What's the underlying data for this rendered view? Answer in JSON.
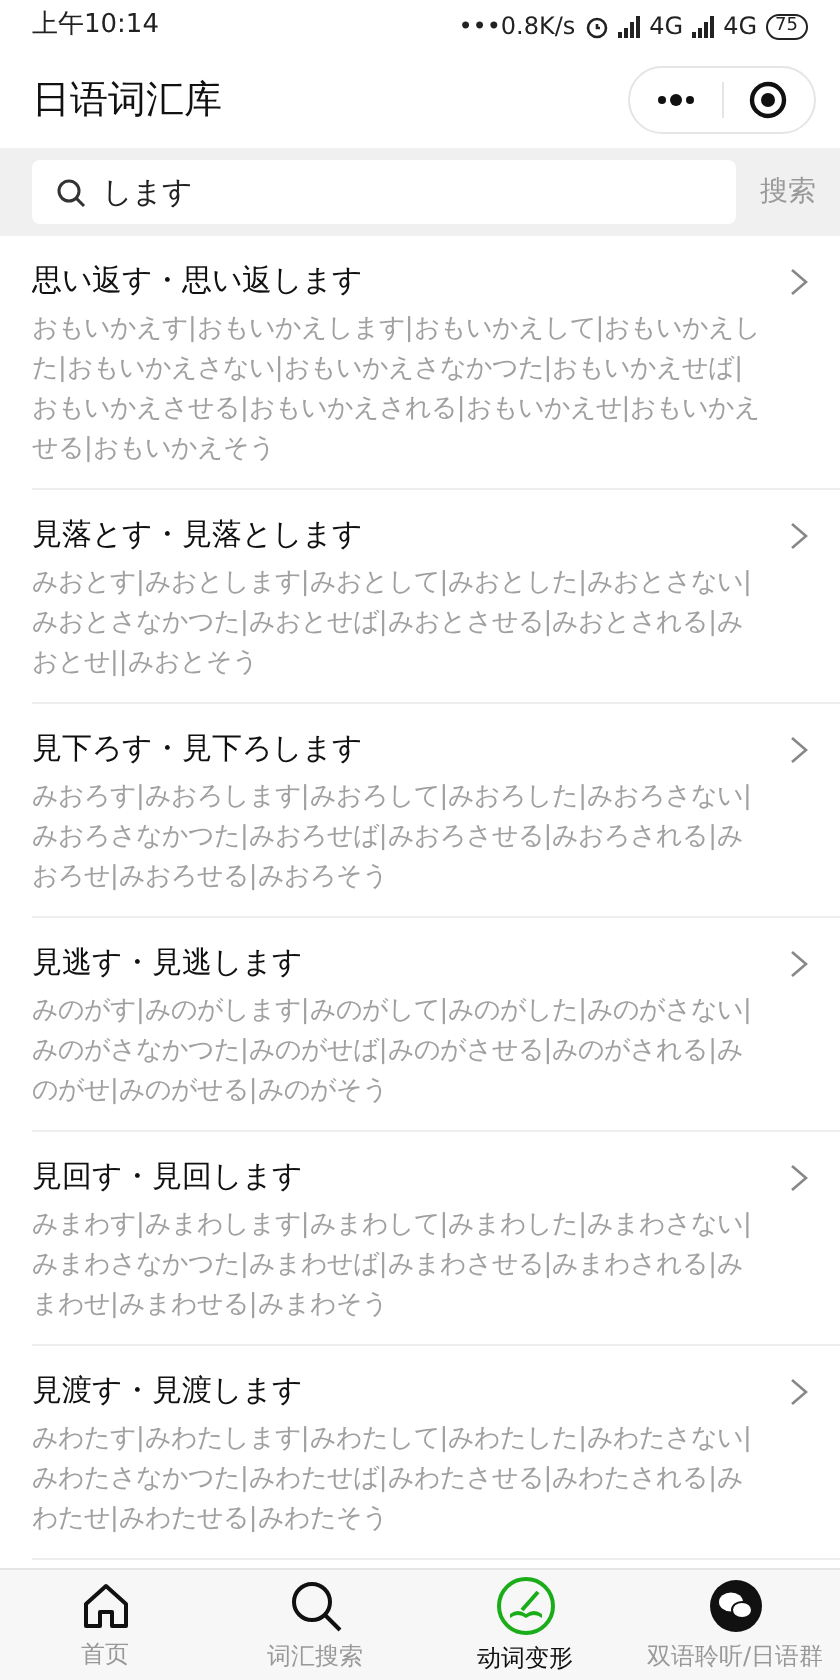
{
  "status_bar": {
    "time": "上午10:14",
    "speed": "•••0.8K/s",
    "network_1": "4G",
    "network_2": "4G",
    "battery": "75"
  },
  "header": {
    "title": "日语词汇库"
  },
  "search": {
    "value": "します",
    "button": "搜索"
  },
  "verbs": [
    {
      "title": "思い返す・思い返します",
      "forms": "おもいかえす|おもいかえします|おもいかえして|おもいかえした|おもいかえさない|おもいかえさなかつた|おもいかえせば|おもいかえさせる|おもいかえされる|おもいかえせ|おもいかえせる|おもいかえそう"
    },
    {
      "title": "見落とす・見落とします",
      "forms": "みおとす|みおとします|みおとして|みおとした|みおとさない|みおとさなかつた|みおとせば|みおとさせる|みおとされる|みおとせ||みおとそう"
    },
    {
      "title": "見下ろす・見下ろします",
      "forms": "みおろす|みおろします|みおろして|みおろした|みおろさない|みおろさなかつた|みおろせば|みおろさせる|みおろされる|みおろせ|みおろせる|みおろそう"
    },
    {
      "title": "見逃す・見逃します",
      "forms": "みのがす|みのがします|みのがして|みのがした|みのがさない|みのがさなかつた|みのがせば|みのがさせる|みのがされる|みのがせ|みのがせる|みのがそう"
    },
    {
      "title": "見回す・見回します",
      "forms": "みまわす|みまわします|みまわして|みまわした|みまわさない|みまわさなかつた|みまわせば|みまわさせる|みまわされる|みまわせ|みまわせる|みまわそう"
    },
    {
      "title": "見渡す・見渡します",
      "forms": "みわたす|みわたします|みわたして|みわたした|みわたさない|みわたさなかつた|みわたせば|みわたさせる|みわたされる|みわたせ|みわたせる|みわたそう"
    }
  ],
  "tabs": [
    {
      "kind": "home",
      "label": "首页",
      "selected": false
    },
    {
      "kind": "search",
      "label": "词汇搜索",
      "selected": false
    },
    {
      "kind": "verb",
      "label": "动词变形",
      "selected": true
    },
    {
      "kind": "chat",
      "label": "双语聆听/日语群",
      "selected": false
    }
  ]
}
